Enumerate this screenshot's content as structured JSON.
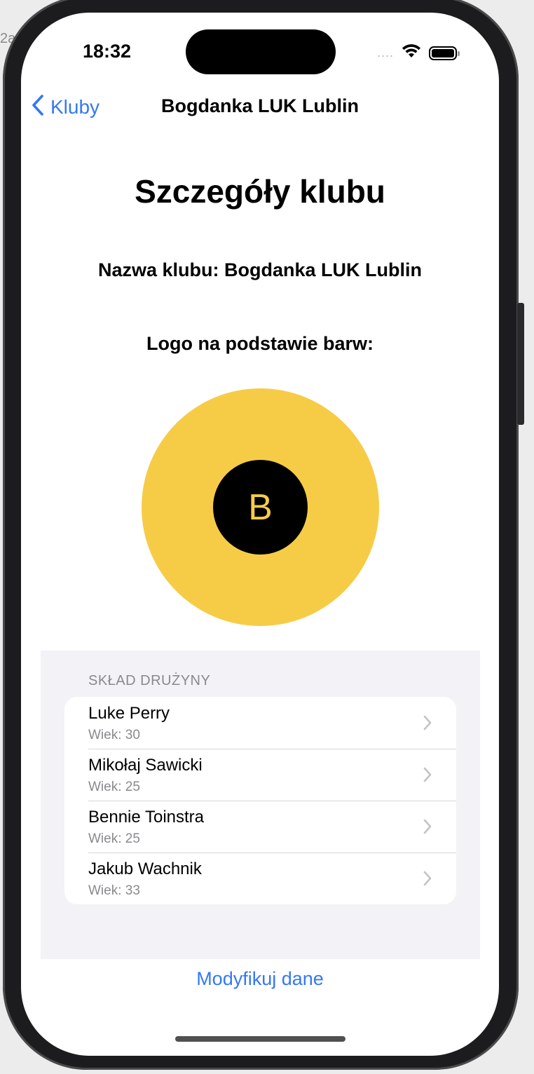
{
  "desktop": {
    "fragment_text": "2a"
  },
  "status_bar": {
    "time": "18:32",
    "signal": "....",
    "wifi_icon": "wifi-icon",
    "battery_icon": "battery-icon"
  },
  "nav": {
    "back_label": "Kluby",
    "title": "Bogdanka LUK Lublin"
  },
  "page": {
    "heading": "Szczegóły klubu",
    "club_name_line": "Nazwa klubu: Bogdanka LUK Lublin",
    "logo_label": "Logo na podstawie barw:"
  },
  "logo": {
    "letter": "B",
    "outer_color": "#f6cc47",
    "inner_color": "#000000",
    "letter_color": "#f6cc47"
  },
  "roster": {
    "section_title": "SKŁAD DRUŻYNY",
    "players": [
      {
        "name": "Luke Perry",
        "age": "Wiek: 30"
      },
      {
        "name": "Mikołaj Sawicki",
        "age": "Wiek: 25"
      },
      {
        "name": "Bennie Toinstra",
        "age": "Wiek: 25"
      },
      {
        "name": "Jakub Wachnik",
        "age": "Wiek: 33"
      }
    ]
  },
  "actions": {
    "modify_label": "Modyfikuj dane"
  },
  "colors": {
    "accent": "#3478f6",
    "secondary_text": "#8a8a8e"
  }
}
